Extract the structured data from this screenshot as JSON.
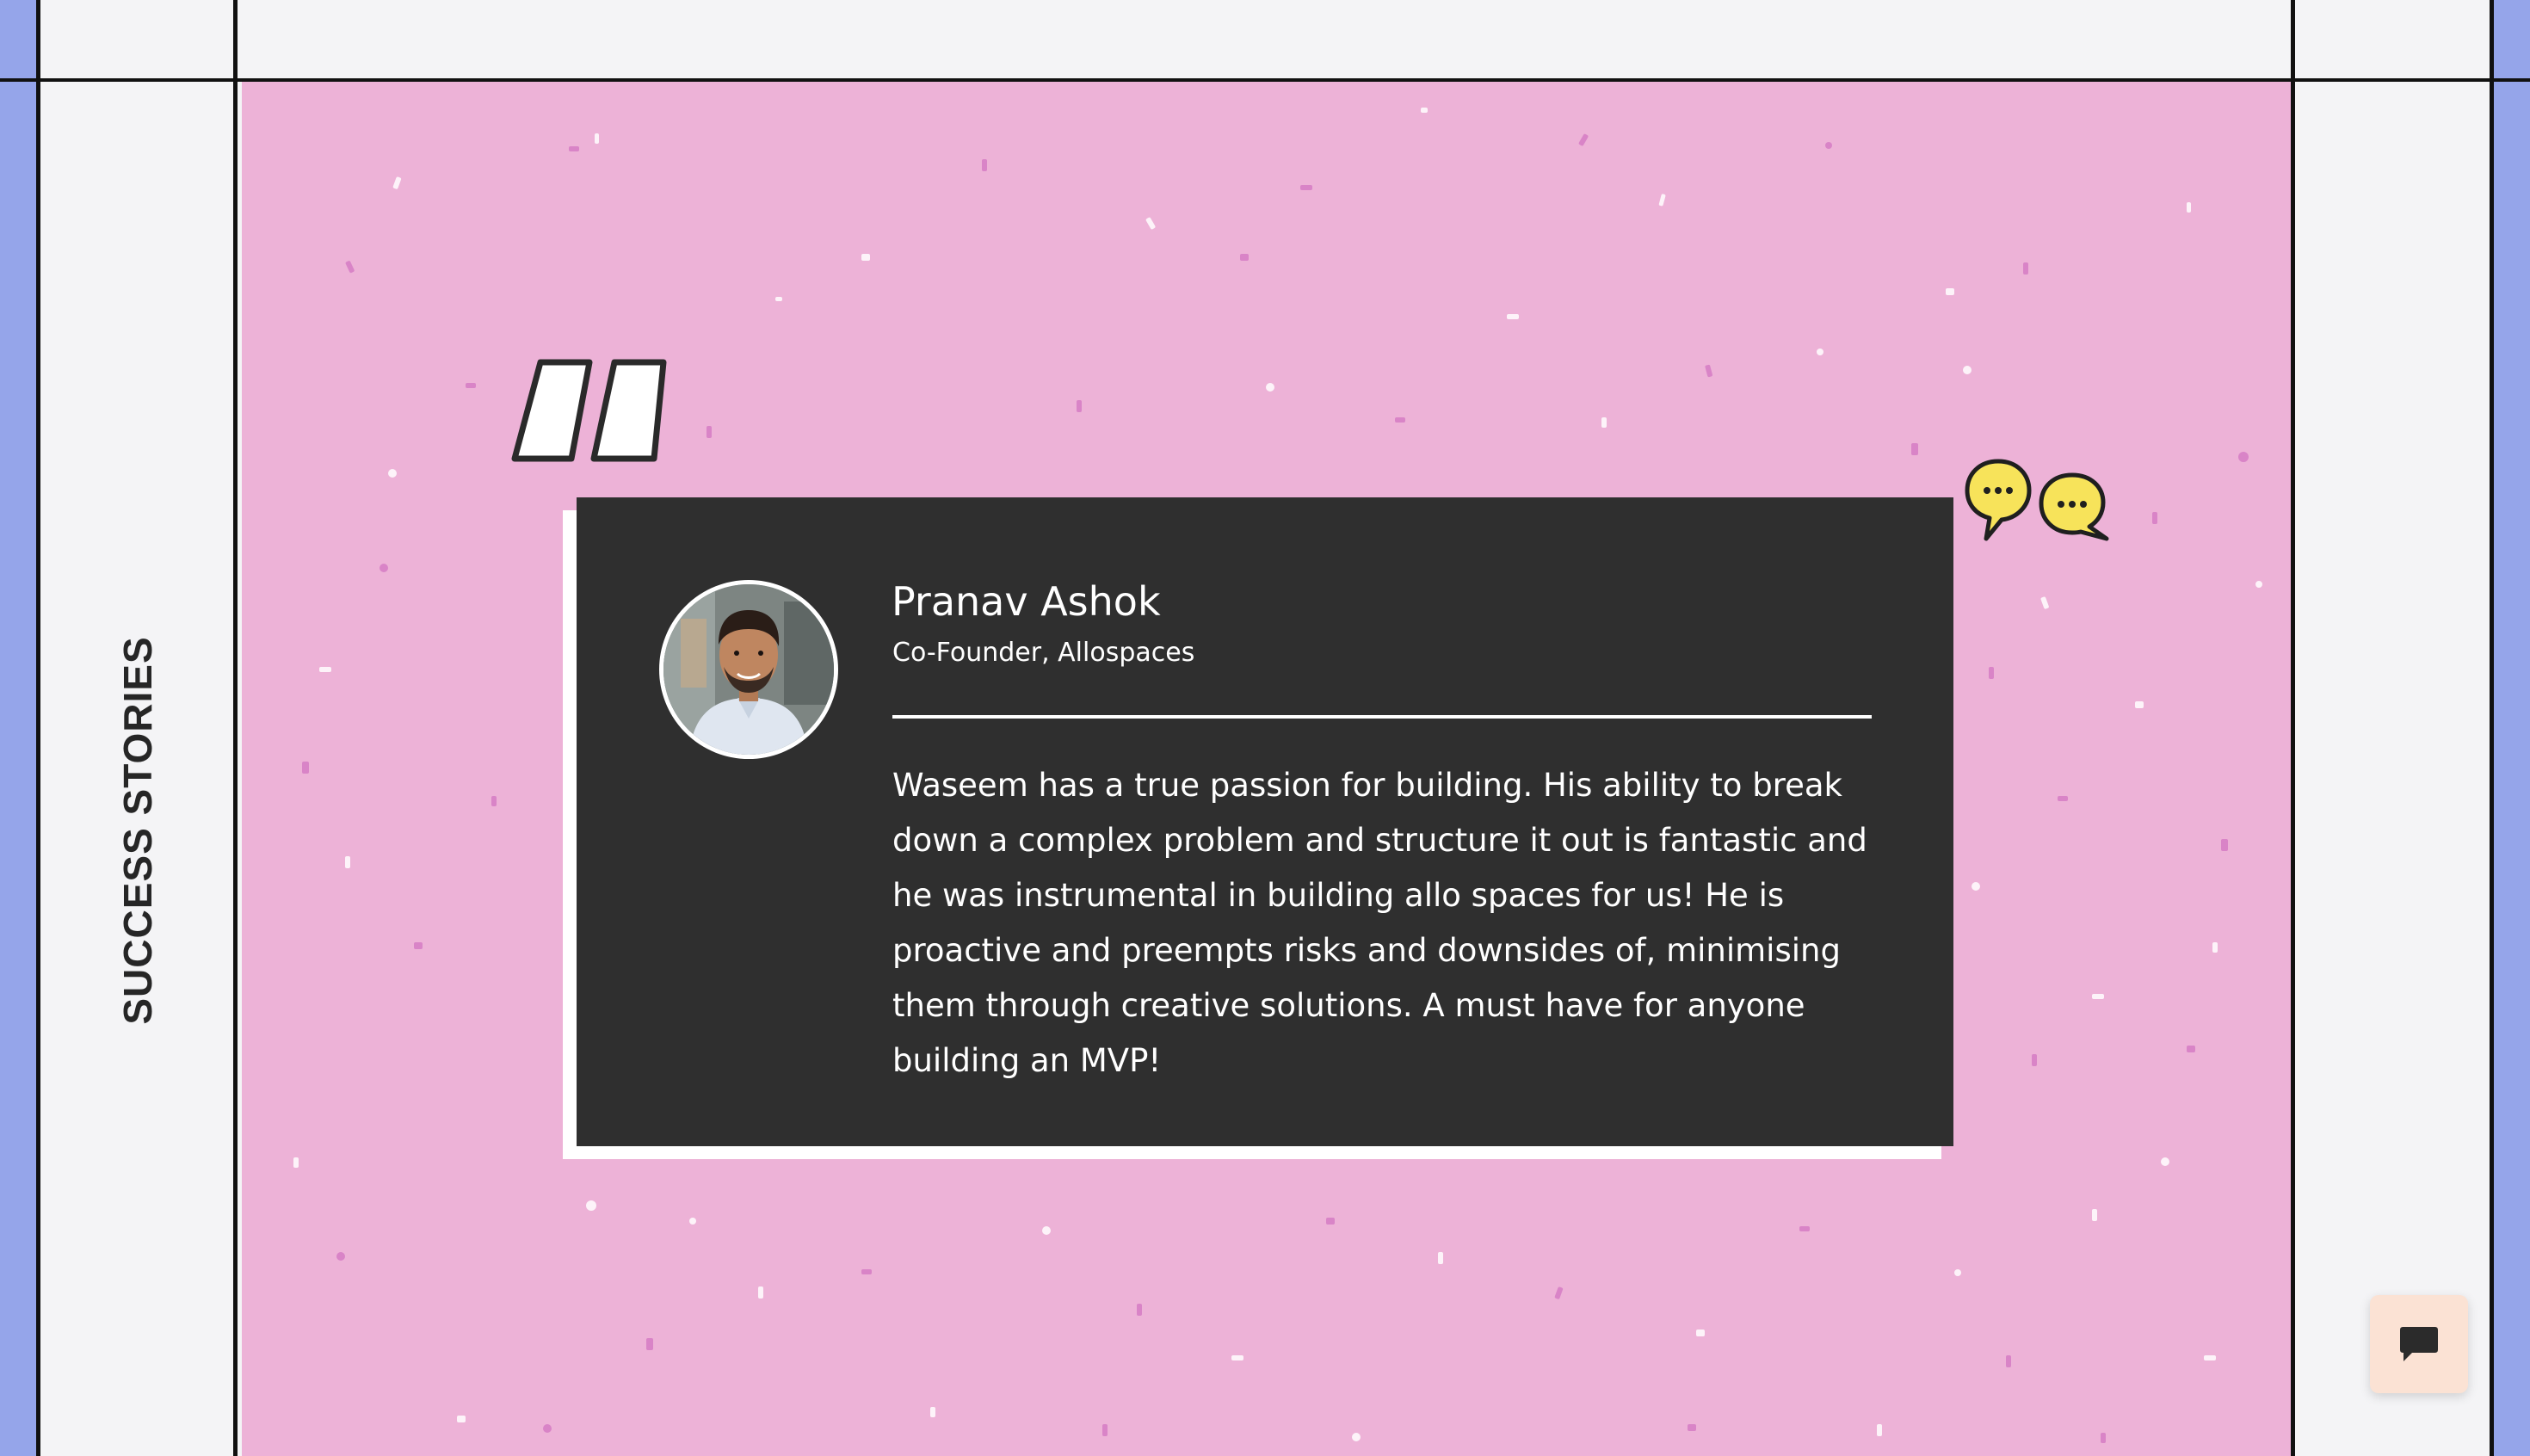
{
  "section": {
    "label": "SUCCESS STORIES"
  },
  "testimonial": {
    "name": "Pranav Ashok",
    "role": "Co-Founder, Allospaces",
    "quote": "Waseem has a true passion for building. His ability to break down a complex problem and structure it out is fantastic and he was instrumental in building allo spaces for us! He is proactive and preempts risks and downsides of, minimising them through creative solutions. A must have for anyone building an MVP!"
  },
  "icons": {
    "quote": "quote-mark-icon",
    "chat_bubbles": "speech-bubbles-icon",
    "chat_launcher": "chat-icon"
  },
  "colors": {
    "side_edge": "#95a5ea",
    "panel_bg": "#edb2d7",
    "card_bg": "#2f2f2f",
    "bubble_yellow": "#f7e35a",
    "chat_button_bg": "#fbe2d4"
  }
}
